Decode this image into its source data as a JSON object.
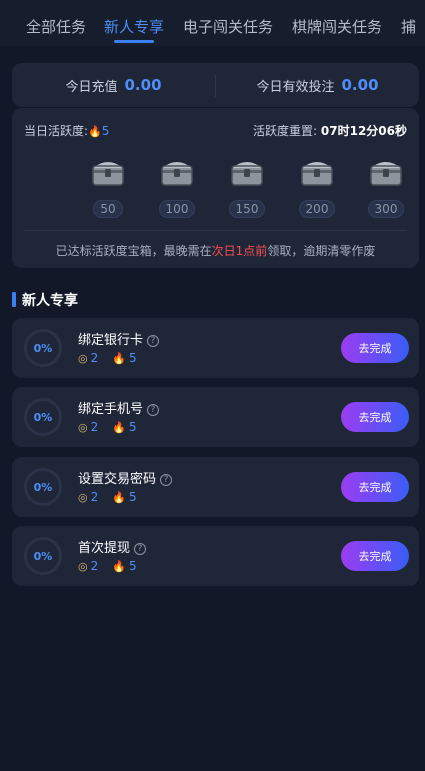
{
  "tabs": [
    {
      "label": "全部任务"
    },
    {
      "label": "新人专享"
    },
    {
      "label": "电子闯关任务"
    },
    {
      "label": "棋牌闯关任务"
    },
    {
      "label": "捕"
    }
  ],
  "active_tab": 1,
  "summary": {
    "recharge_label": "今日充值",
    "recharge_value": "0.00",
    "bet_label": "今日有效投注",
    "bet_value": "0.00"
  },
  "activity": {
    "label": "当日活跃度:",
    "value": "5",
    "reset_label": "活跃度重置:",
    "reset_time": "07时12分06秒",
    "chests": [
      {
        "threshold": "50"
      },
      {
        "threshold": "100"
      },
      {
        "threshold": "150"
      },
      {
        "threshold": "200"
      },
      {
        "threshold": "300"
      }
    ],
    "note_prefix": "已达标活跃度宝箱，最晚需在",
    "note_highlight": "次日1点前",
    "note_suffix": "领取，逾期清零作废"
  },
  "section_title": "新人专享",
  "tasks": [
    {
      "name": "绑定银行卡",
      "progress": "0%",
      "coin_reward": "2",
      "activity_reward": "5",
      "button": "去完成"
    },
    {
      "name": "绑定手机号",
      "progress": "0%",
      "coin_reward": "2",
      "activity_reward": "5",
      "button": "去完成"
    },
    {
      "name": "设置交易密码",
      "progress": "0%",
      "coin_reward": "2",
      "activity_reward": "5",
      "button": "去完成"
    },
    {
      "name": "首次提现",
      "progress": "0%",
      "coin_reward": "2",
      "activity_reward": "5",
      "button": "去完成"
    }
  ],
  "colors": {
    "accent": "#4f8ef7",
    "highlight_red": "#ff4d4f",
    "button_gradient_start": "#9b3df2",
    "button_gradient_end": "#3a5df5"
  }
}
